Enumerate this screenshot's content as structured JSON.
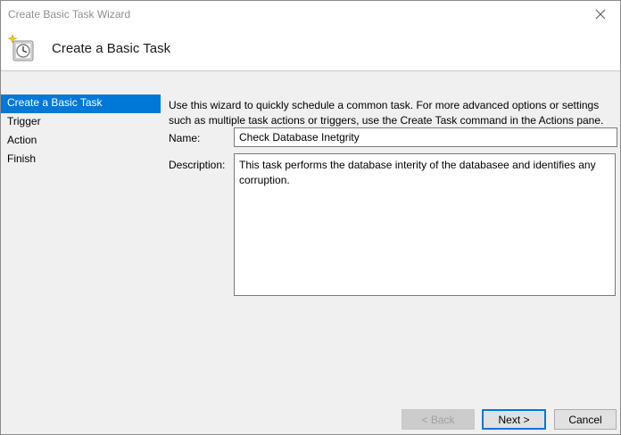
{
  "window": {
    "title": "Create Basic Task Wizard"
  },
  "header": {
    "title": "Create a Basic Task",
    "icon": "task-scheduler-clock-icon"
  },
  "sidebar": {
    "items": [
      {
        "label": "Create a Basic Task",
        "selected": true
      },
      {
        "label": "Trigger",
        "selected": false
      },
      {
        "label": "Action",
        "selected": false
      },
      {
        "label": "Finish",
        "selected": false
      }
    ]
  },
  "main": {
    "intro": "Use this wizard to quickly schedule a common task.  For more advanced options or settings such as multiple task actions or triggers, use the Create Task command in the Actions pane.",
    "name_label": "Name:",
    "name_value": "Check Database Inetgrity",
    "description_label": "Description:",
    "description_value": "This task performs the database interity of the databasee and identifies any corruption."
  },
  "buttons": {
    "back": "< Back",
    "next": "Next >",
    "cancel": "Cancel"
  },
  "colors": {
    "accent": "#0078d7"
  }
}
